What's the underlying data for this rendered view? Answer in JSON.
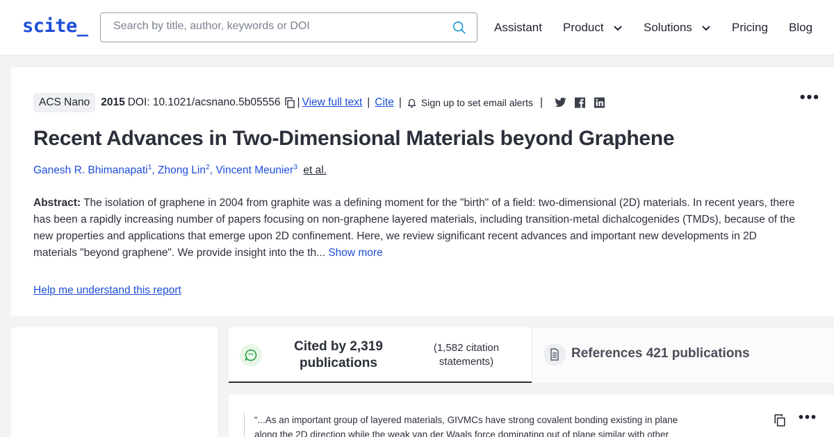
{
  "header": {
    "logo": "scite_",
    "search_placeholder": "Search by title, author, keywords or DOI",
    "nav": {
      "assistant": "Assistant",
      "product": "Product",
      "solutions": "Solutions",
      "pricing": "Pricing",
      "blog": "Blog"
    }
  },
  "paper": {
    "journal": "ACS Nano",
    "year": "2015",
    "doi": "DOI: 10.1021/acsnano.5b05556",
    "view_full_text": "View full text",
    "cite": "Cite",
    "alerts": "Sign up to set email alerts",
    "title": "Recent Advances in Two-Dimensional Materials beyond Graphene",
    "authors": [
      {
        "name": "Ganesh R. Bhimanapati",
        "sup": "1"
      },
      {
        "name": "Zhong Lin",
        "sup": "2"
      },
      {
        "name": "Vincent Meunier",
        "sup": "3"
      }
    ],
    "et_al": "et al.",
    "abstract_label": "Abstract:",
    "abstract_text": "The isolation of graphene in 2004 from graphite was a defining moment for the \"birth\" of a field: two-dimensional (2D) materials. In recent years, there has been a rapidly increasing number of papers focusing on non-graphene layered materials, including transition-metal dichalcogenides (TMDs), because of the new properties and applications that emerge upon 2D confinement. Here, we review significant recent advances and important new developments in 2D materials \"beyond graphene\". We provide insight into the th...",
    "show_more": "Show more",
    "help_link": "Help me understand this report"
  },
  "tabs": {
    "cited_main": "Cited by 2,319 publications",
    "cited_sub": "(1,582 citation statements)",
    "references": "References 421 publications"
  },
  "citation": {
    "quote": "“...As an important group of layered materials, GIVMCs have strong covalent bonding existing in plane along the 2D direction while the weak van der Waals force dominating out of plane similar with other"
  },
  "colors": {
    "brand_blue": "#1d4ed8",
    "cited_icon_bg": "#e8f6e8",
    "cited_icon_fg": "#1f9d3a"
  }
}
